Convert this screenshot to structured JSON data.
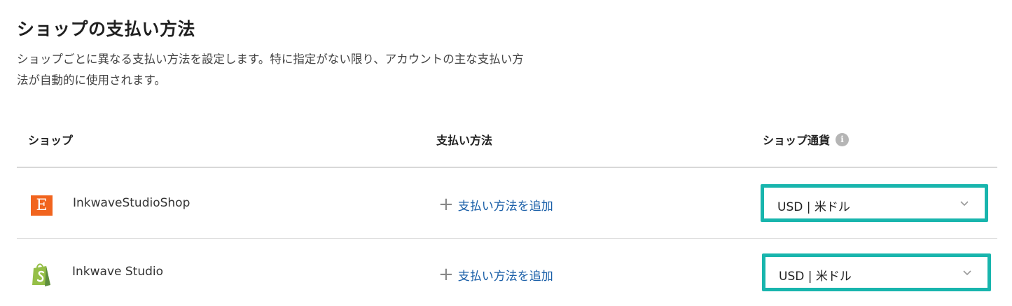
{
  "page": {
    "title": "ショップの支払い方法",
    "description_line1": "ショップごとに異なる支払い方法を設定します。特に指定がない限り、アカウントの主な支払い方",
    "description_line2": "法が自動的に使用されます。"
  },
  "table": {
    "headers": {
      "shop": "ショップ",
      "payment": "支払い方法",
      "currency": "ショップ通貨"
    },
    "rows": [
      {
        "platform_icon": "etsy-logo",
        "logo_letter": "E",
        "shop_name": "InkwaveStudioShop",
        "add_payment_label": "支払い方法を追加",
        "currency": "USD | 米ドル"
      },
      {
        "platform_icon": "shopify-logo",
        "shop_name": "Inkwave Studio",
        "add_payment_label": "支払い方法を追加",
        "currency": "USD | 米ドル"
      }
    ]
  },
  "colors": {
    "accent_border": "#18b5ad",
    "link": "#1a5fa8",
    "etsy_orange": "#f1641e",
    "shopify_green": "#95bf47"
  }
}
